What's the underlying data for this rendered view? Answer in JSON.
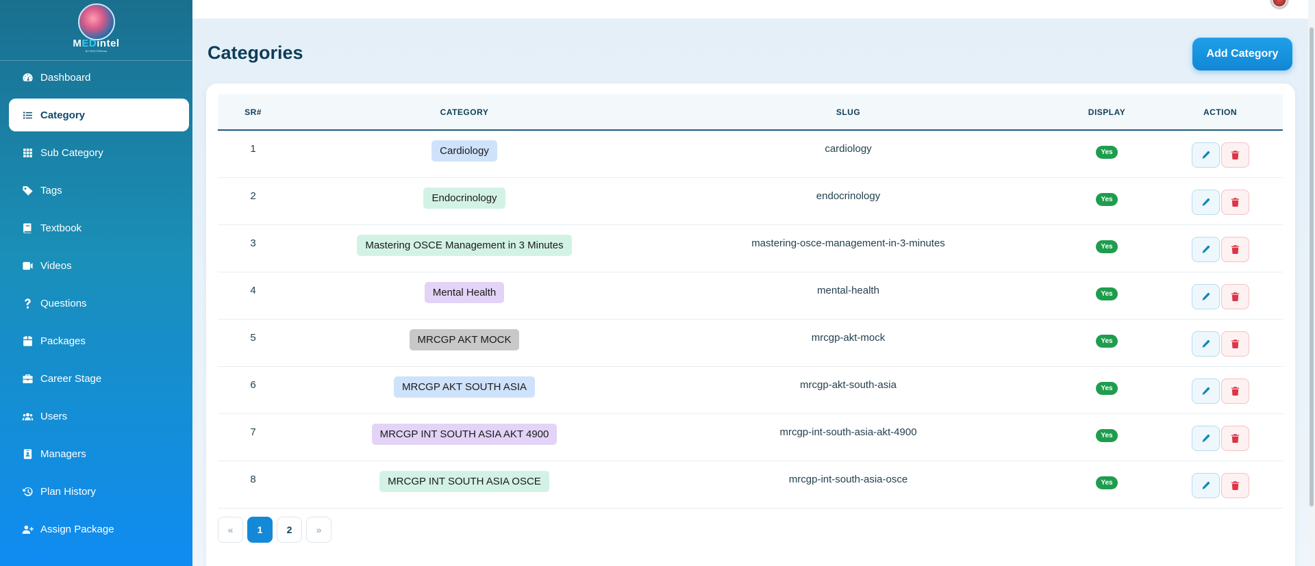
{
  "brand": {
    "logo_prefix": "M",
    "logo_accent": "ED",
    "logo_suffix": "intel",
    "logo_sub": "BY DOCTORmed"
  },
  "sidebar": {
    "items": [
      {
        "label": "Dashboard",
        "icon": "dashboard-icon",
        "active": false
      },
      {
        "label": "Category",
        "icon": "list-icon",
        "active": true
      },
      {
        "label": "Sub Category",
        "icon": "grid-icon",
        "active": false
      },
      {
        "label": "Tags",
        "icon": "tag-icon",
        "active": false
      },
      {
        "label": "Textbook",
        "icon": "book-icon",
        "active": false
      },
      {
        "label": "Videos",
        "icon": "video-icon",
        "active": false
      },
      {
        "label": "Questions",
        "icon": "question-icon",
        "active": false
      },
      {
        "label": "Packages",
        "icon": "box-icon",
        "active": false
      },
      {
        "label": "Career Stage",
        "icon": "briefcase-icon",
        "active": false
      },
      {
        "label": "Users",
        "icon": "users-icon",
        "active": false
      },
      {
        "label": "Managers",
        "icon": "id-badge-icon",
        "active": false
      },
      {
        "label": "Plan History",
        "icon": "history-icon",
        "active": false
      },
      {
        "label": "Assign Package",
        "icon": "user-plus-icon",
        "active": false
      }
    ]
  },
  "page": {
    "title": "Categories",
    "add_button": "Add Category"
  },
  "table": {
    "headers": [
      "SR#",
      "CATEGORY",
      "SLUG",
      "DISPLAY",
      "ACTION"
    ],
    "rows": [
      {
        "sr": "1",
        "category": "Cardiology",
        "slug": "cardiology",
        "display": "Yes",
        "pill_color": "#cfe2fb"
      },
      {
        "sr": "2",
        "category": "Endocrinology",
        "slug": "endocrinology",
        "display": "Yes",
        "pill_color": "#d3f2e6"
      },
      {
        "sr": "3",
        "category": "Mastering OSCE Management in 3 Minutes",
        "slug": "mastering-osce-management-in-3-minutes",
        "display": "Yes",
        "pill_color": "#d3f2e6"
      },
      {
        "sr": "4",
        "category": "Mental Health",
        "slug": "mental-health",
        "display": "Yes",
        "pill_color": "#e2d3f7"
      },
      {
        "sr": "5",
        "category": "MRCGP AKT MOCK",
        "slug": "mrcgp-akt-mock",
        "display": "Yes",
        "pill_color": "#c8c8c8"
      },
      {
        "sr": "6",
        "category": "MRCGP AKT SOUTH ASIA",
        "slug": "mrcgp-akt-south-asia",
        "display": "Yes",
        "pill_color": "#cfe2fb"
      },
      {
        "sr": "7",
        "category": "MRCGP INT SOUTH ASIA AKT 4900",
        "slug": "mrcgp-int-south-asia-akt-4900",
        "display": "Yes",
        "pill_color": "#e2d3f7"
      },
      {
        "sr": "8",
        "category": "MRCGP INT SOUTH ASIA OSCE",
        "slug": "mrcgp-int-south-asia-osce",
        "display": "Yes",
        "pill_color": "#d3f2e6"
      }
    ]
  },
  "pagination": {
    "prev": "«",
    "pages": [
      "1",
      "2"
    ],
    "current": "1",
    "next": "»"
  },
  "colors": {
    "accent": "#1389d8",
    "success": "#1f9d4e",
    "danger": "#dc3545"
  }
}
